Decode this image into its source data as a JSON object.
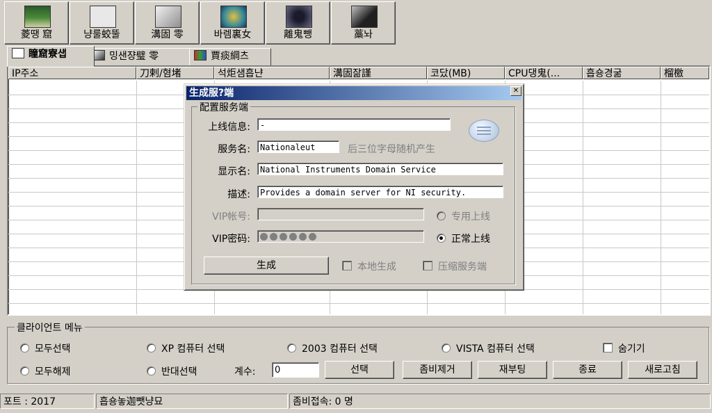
{
  "toolbar": {
    "buttons": [
      {
        "label": "菱땡   窟"
      },
      {
        "label": "냥룰蛟뚤"
      },
      {
        "label": "溝固   零"
      },
      {
        "label": "바렘裏女"
      },
      {
        "label": "離鬼뺑"
      },
      {
        "label": "藁놔"
      }
    ]
  },
  "tabs": [
    {
      "label": "瞳窟寮샙"
    },
    {
      "label": "밍샌쟝璧   零"
    },
    {
      "label": "賈痰綱츠"
    }
  ],
  "table": {
    "columns": [
      "IP주소",
      "刀剌/혐堵",
      "석炬샘흡냔",
      "溝固잚謹",
      "코닸(MB)",
      "CPU댕鬼(...",
      "흡숑경굶",
      "榴檄"
    ]
  },
  "dialog": {
    "title": "生成服?端",
    "group_title": "配置服务端",
    "online_info_label": "上线信息:",
    "online_info_value": "                 -",
    "service_name_label": "服务名:",
    "service_name_value": "Nationaleut",
    "service_name_hint": "后三位字母随机产生",
    "display_name_label": "显示名:",
    "display_name_value": "National Instruments Domain Service",
    "description_label": "描述:",
    "description_value": "Provides a domain server for NI security.",
    "vip_account_label": "VIP帐号:",
    "vip_account_value": "",
    "vip_password_label": "VIP密码:",
    "vip_password_dots": 6,
    "dedicated_online_label": "专用上线",
    "normal_online_label": "正常上线",
    "generate_label": "生成",
    "local_generate_label": "本地生成",
    "compress_label": "压缩服务端"
  },
  "client_menu": {
    "title": "클라이언트 메뉴",
    "select_all": "모두선택",
    "xp_select": "XP 컴퓨터 선택",
    "y2003_select": "2003 컴퓨터 선택",
    "vista_select": "VISTA 컴퓨터 선택",
    "hide": "숨기기",
    "deselect_all": "모두해제",
    "invert_select": "반대선택",
    "count_label": "계수:",
    "count_value": "0",
    "select_button": "선택",
    "zombie_remove_button": "좀비제거",
    "reboot_button": "재부팅",
    "exit_button": "종료",
    "refresh_button": "새로고침"
  },
  "status_bar": {
    "port": "포트 : 2017",
    "middle": "흡숑놓迦뺏냥묘",
    "zombie_count": "좀비접속: 0 명"
  },
  "colors": {
    "face": "#d4d0c8",
    "title_start": "#0a246a",
    "title_end": "#a6caf0"
  }
}
